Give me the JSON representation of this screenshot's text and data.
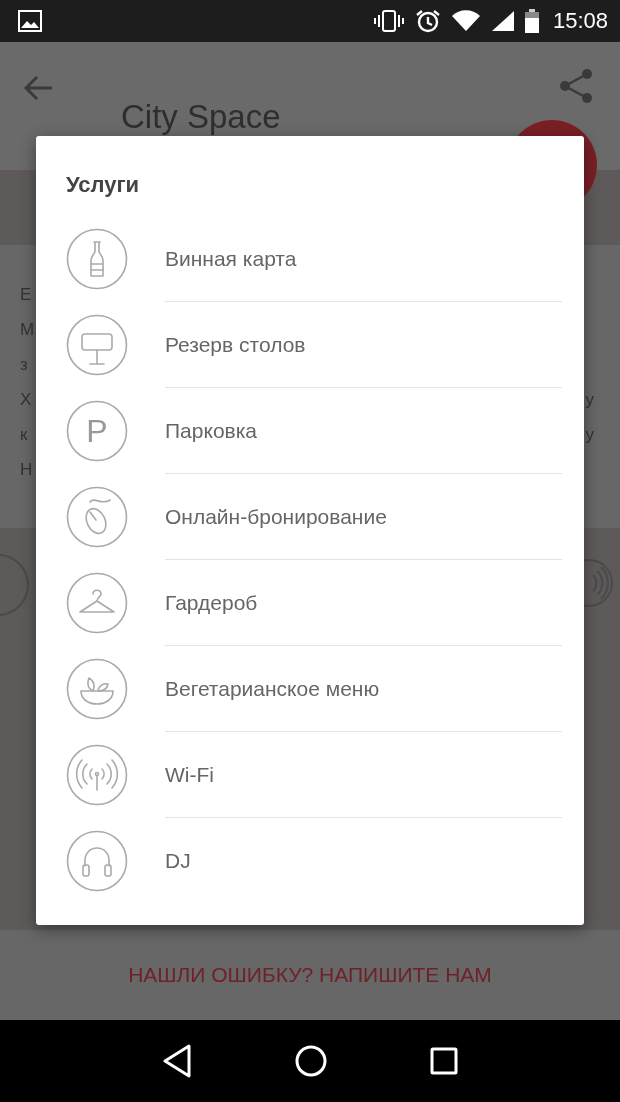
{
  "status_bar": {
    "time": "15:08"
  },
  "app_bar": {
    "title": "City Space"
  },
  "description": {
    "lines": [
      {
        "start": "Е"
      },
      {
        "start": "М"
      },
      {
        "start": "з"
      },
      {
        "start": "Х",
        "end": "у"
      },
      {
        "start": "к",
        "end": "у"
      },
      {
        "start": "Н"
      }
    ]
  },
  "dialog": {
    "title": "Услуги",
    "items": [
      {
        "label": "Винная карта",
        "kind": "wine"
      },
      {
        "label": "Резерв столов",
        "kind": "table"
      },
      {
        "label": "Парковка",
        "kind": "parking",
        "icon_text": "P"
      },
      {
        "label": "Онлайн-бронирование",
        "kind": "mouse"
      },
      {
        "label": "Гардероб",
        "kind": "hanger"
      },
      {
        "label": "Вегетарианское меню",
        "kind": "salad"
      },
      {
        "label": "Wi-Fi",
        "kind": "wifi"
      },
      {
        "label": "DJ",
        "kind": "headphones"
      }
    ]
  },
  "feedback_link": "НАШЛИ ОШИБКУ? НАПИШИТЕ НАМ"
}
